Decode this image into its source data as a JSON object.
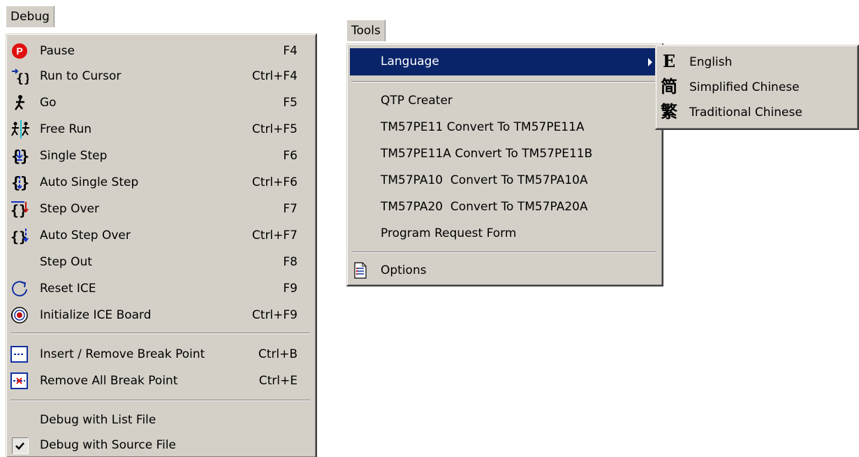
{
  "debug_menu": {
    "title": "Debug",
    "items": [
      {
        "label": "Pause",
        "shortcut": "F4",
        "icon": "pause-icon"
      },
      {
        "label": "Run to Cursor",
        "shortcut": "Ctrl+F4",
        "icon": "run-to-cursor-icon"
      },
      {
        "label": "Go",
        "shortcut": "F5",
        "icon": "go-runner-icon"
      },
      {
        "label": "Free Run",
        "shortcut": "Ctrl+F5",
        "icon": "free-run-icon"
      },
      {
        "label": "Single Step",
        "shortcut": "F6",
        "icon": "single-step-icon"
      },
      {
        "label": "Auto Single Step",
        "shortcut": "Ctrl+F6",
        "icon": "auto-single-step-icon"
      },
      {
        "label": "Step Over",
        "shortcut": "F7",
        "icon": "step-over-icon"
      },
      {
        "label": "Auto Step Over",
        "shortcut": "Ctrl+F7",
        "icon": "auto-step-over-icon"
      },
      {
        "label": "Step Out",
        "shortcut": "F8",
        "icon": ""
      },
      {
        "label": "Reset ICE",
        "shortcut": "F9",
        "icon": "reset-icon"
      },
      {
        "label": "Initialize ICE Board",
        "shortcut": "Ctrl+F9",
        "icon": "initialize-board-icon"
      },
      {
        "label": "Insert / Remove Break Point",
        "shortcut": "Ctrl+B",
        "icon": "breakpoint-icon"
      },
      {
        "label": "Remove All Break Point",
        "shortcut": "Ctrl+E",
        "icon": "remove-breakpoints-icon"
      },
      {
        "label": "Debug with List File",
        "shortcut": "",
        "icon": ""
      },
      {
        "label": "Debug with Source File",
        "shortcut": "",
        "icon": "checkmark-icon",
        "checked": true
      }
    ]
  },
  "tools_menu": {
    "title": "Tools",
    "items": [
      {
        "label": "Language",
        "submenu": true,
        "highlighted": true
      },
      {
        "label": "QTP Creater"
      },
      {
        "label": "TM57PE11 Convert To TM57PE11A"
      },
      {
        "label": "TM57PE11A Convert To TM57PE11B"
      },
      {
        "label": "TM57PA10  Convert To TM57PA10A"
      },
      {
        "label": "TM57PA20  Convert To TM57PA20A"
      },
      {
        "label": "Program Request Form"
      },
      {
        "label": "Options",
        "icon": "options-icon"
      }
    ]
  },
  "language_submenu": {
    "items": [
      {
        "label": "English",
        "glyph": "E"
      },
      {
        "label": "Simplified Chinese",
        "glyph": "简"
      },
      {
        "label": "Traditional Chinese",
        "glyph": "繁"
      }
    ]
  },
  "colors": {
    "menu_bg": "#d4d0c8",
    "highlight": "#0a246a"
  }
}
